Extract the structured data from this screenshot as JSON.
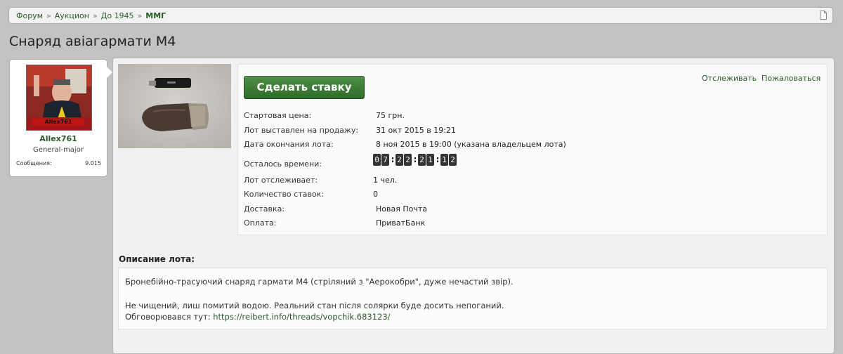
{
  "breadcrumb": {
    "items": [
      "Форум",
      "Аукцион",
      "До 1945"
    ],
    "current": "ММГ",
    "separator": "»"
  },
  "page": {
    "title": "Снаряд авіагармати М4"
  },
  "user": {
    "avatar_tag": "Allex761",
    "name": "Allex761",
    "rank": "General-major",
    "stat_label": "Сообщения:",
    "stat_value": "9.015"
  },
  "lot": {
    "bid_button": "Сделать ставку",
    "watch_link": "Отслеживать",
    "report_link": "Пожаловаться",
    "fields": [
      {
        "label": "Стартовая цена:",
        "value": "75 грн."
      },
      {
        "label": "Лот выставлен на продажу:",
        "value": "31 окт 2015 в 19:21"
      },
      {
        "label": "Дата окончания лота:",
        "value": "8 ноя 2015 в 19:00 (указана владельцем лота)"
      },
      {
        "label": "Осталось времени:",
        "value": ""
      },
      {
        "label": "Лот отслеживает:",
        "value": "1 чел."
      },
      {
        "label": "Количество ставок:",
        "value": "0"
      },
      {
        "label": "Доставка:",
        "value": "Новая Почта"
      },
      {
        "label": "Оплата:",
        "value": "ПриватБанк"
      }
    ],
    "countdown": [
      "0",
      "7",
      "2",
      "2",
      "2",
      "1",
      "1",
      "2"
    ]
  },
  "description": {
    "title": "Описание лота:",
    "line1": "Бронебійно-трасуючий снаряд гармати М4 (стріляний з \"Аерокобри\", дуже нечастий звір).",
    "line2": "Не чищений, лиш помитий водою. Реальний стан після солярки буде досить непоганий.",
    "line3_prefix": "Обговорювався тут:",
    "line3_link": "https://reibert.info/threads/vopchik.683123/"
  },
  "colors": {
    "accent": "#2d5a2a",
    "button": "#3d7a36",
    "background": "#c3c3c3"
  }
}
